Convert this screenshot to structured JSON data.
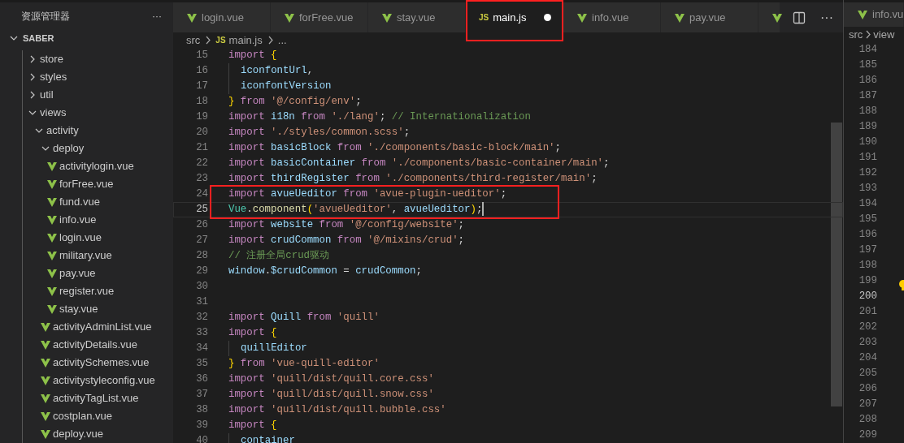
{
  "explorer": {
    "title": "资源管理器",
    "more": "···",
    "root": {
      "label": "SABER",
      "expanded": true
    },
    "items": [
      {
        "label": "store",
        "kind": "folder",
        "expanded": false
      },
      {
        "label": "styles",
        "kind": "folder",
        "expanded": false
      },
      {
        "label": "util",
        "kind": "folder",
        "expanded": false
      },
      {
        "label": "views",
        "kind": "folder",
        "expanded": true,
        "children": [
          {
            "label": "activity",
            "kind": "folder",
            "expanded": true,
            "children": [
              {
                "label": "deploy",
                "kind": "folder",
                "expanded": true,
                "children": [
                  {
                    "label": "activitylogin.vue",
                    "kind": "vue"
                  },
                  {
                    "label": "forFree.vue",
                    "kind": "vue"
                  },
                  {
                    "label": "fund.vue",
                    "kind": "vue"
                  },
                  {
                    "label": "info.vue",
                    "kind": "vue"
                  },
                  {
                    "label": "login.vue",
                    "kind": "vue"
                  },
                  {
                    "label": "military.vue",
                    "kind": "vue"
                  },
                  {
                    "label": "pay.vue",
                    "kind": "vue"
                  },
                  {
                    "label": "register.vue",
                    "kind": "vue"
                  },
                  {
                    "label": "stay.vue",
                    "kind": "vue"
                  }
                ]
              },
              {
                "label": "activityAdminList.vue",
                "kind": "vue"
              },
              {
                "label": "activityDetails.vue",
                "kind": "vue"
              },
              {
                "label": "activitySchemes.vue",
                "kind": "vue"
              },
              {
                "label": "activitystyleconfig.vue",
                "kind": "vue"
              },
              {
                "label": "activityTagList.vue",
                "kind": "vue"
              },
              {
                "label": "costplan.vue",
                "kind": "vue"
              },
              {
                "label": "deploy.vue",
                "kind": "vue"
              }
            ]
          }
        ]
      }
    ]
  },
  "tabs": [
    {
      "label": "login.vue",
      "kind": "vue",
      "selected": false
    },
    {
      "label": "forFree.vue",
      "kind": "vue",
      "selected": false
    },
    {
      "label": "stay.vue",
      "kind": "vue",
      "selected": false
    },
    {
      "label": "main.js",
      "kind": "js",
      "badge": "JS",
      "selected": true,
      "modified": true,
      "annotated": true
    },
    {
      "label": "info.vue",
      "kind": "vue",
      "selected": false
    },
    {
      "label": "pay.vue",
      "kind": "vue",
      "selected": false
    },
    {
      "kind": "vue",
      "selected": false
    }
  ],
  "tab_actions": {
    "more": "···"
  },
  "breadcrumb": [
    {
      "text": "src"
    },
    {
      "text": "main.js",
      "badge": "JS"
    },
    {
      "text": "..."
    }
  ],
  "code": [
    {
      "n": "15",
      "tokens": [
        {
          "kind": "kw",
          "text": "import"
        },
        {
          "kind": "brace",
          "text": " {"
        }
      ]
    },
    {
      "n": "16",
      "guide": true,
      "tokens": [
        {
          "kind": "var",
          "text": "iconfontUrl"
        },
        {
          "kind": "punc",
          "text": ","
        }
      ]
    },
    {
      "n": "17",
      "guide": true,
      "tokens": [
        {
          "kind": "var",
          "text": "iconfontVersion"
        }
      ]
    },
    {
      "n": "18",
      "tokens": [
        {
          "kind": "brace",
          "text": "}"
        },
        {
          "kind": "kw",
          "text": " from"
        },
        {
          "kind": "str",
          "text": " '@/config/env'"
        },
        {
          "kind": "punc",
          "text": ";"
        }
      ]
    },
    {
      "n": "19",
      "tokens": [
        {
          "kind": "kw",
          "text": "import"
        },
        {
          "kind": "var",
          "text": " i18n"
        },
        {
          "kind": "kw",
          "text": " from"
        },
        {
          "kind": "str",
          "text": " './lang'"
        },
        {
          "kind": "punc",
          "text": ";"
        },
        {
          "kind": "com",
          "text": " // Internationalization"
        }
      ]
    },
    {
      "n": "20",
      "tokens": [
        {
          "kind": "kw",
          "text": "import"
        },
        {
          "kind": "str",
          "text": " './styles/common.scss'"
        },
        {
          "kind": "punc",
          "text": ";"
        }
      ]
    },
    {
      "n": "21",
      "tokens": [
        {
          "kind": "kw",
          "text": "import"
        },
        {
          "kind": "var",
          "text": " basicBlock"
        },
        {
          "kind": "kw",
          "text": " from"
        },
        {
          "kind": "str",
          "text": " './components/basic-block/main'"
        },
        {
          "kind": "punc",
          "text": ";"
        }
      ]
    },
    {
      "n": "22",
      "tokens": [
        {
          "kind": "kw",
          "text": "import"
        },
        {
          "kind": "var",
          "text": " basicContainer"
        },
        {
          "kind": "kw",
          "text": " from"
        },
        {
          "kind": "str",
          "text": " './components/basic-container/main'"
        },
        {
          "kind": "punc",
          "text": ";"
        }
      ]
    },
    {
      "n": "23",
      "tokens": [
        {
          "kind": "kw",
          "text": "import"
        },
        {
          "kind": "var",
          "text": " thirdRegister"
        },
        {
          "kind": "kw",
          "text": " from"
        },
        {
          "kind": "str",
          "text": " './components/third-register/main'"
        },
        {
          "kind": "punc",
          "text": ";"
        }
      ]
    },
    {
      "n": "24",
      "annotated": true,
      "tokens": [
        {
          "kind": "kw",
          "text": "import"
        },
        {
          "kind": "var",
          "text": " avueUeditor"
        },
        {
          "kind": "kw",
          "text": " from"
        },
        {
          "kind": "str",
          "text": " 'avue-plugin-ueditor'"
        },
        {
          "kind": "punc",
          "text": ";"
        }
      ]
    },
    {
      "n": "25",
      "current": true,
      "annotated": true,
      "tokens": [
        {
          "kind": "cls",
          "text": "Vue"
        },
        {
          "kind": "punc",
          "text": "."
        },
        {
          "kind": "fn",
          "text": "component"
        },
        {
          "kind": "brace",
          "text": "("
        },
        {
          "kind": "str",
          "text": "'avueUeditor'"
        },
        {
          "kind": "punc",
          "text": ","
        },
        {
          "kind": "var",
          "text": " avueUeditor"
        },
        {
          "kind": "brace",
          "text": ")"
        },
        {
          "kind": "punc",
          "text": ";"
        }
      ]
    },
    {
      "n": "26",
      "tokens": [
        {
          "kind": "kw",
          "text": "import"
        },
        {
          "kind": "var",
          "text": " website"
        },
        {
          "kind": "kw",
          "text": " from"
        },
        {
          "kind": "str",
          "text": " '@/config/website'"
        },
        {
          "kind": "punc",
          "text": ";"
        }
      ]
    },
    {
      "n": "27",
      "tokens": [
        {
          "kind": "kw",
          "text": "import"
        },
        {
          "kind": "var",
          "text": " crudCommon"
        },
        {
          "kind": "kw",
          "text": " from"
        },
        {
          "kind": "str",
          "text": " '@/mixins/crud'"
        },
        {
          "kind": "punc",
          "text": ";"
        }
      ]
    },
    {
      "n": "28",
      "tokens": [
        {
          "kind": "com",
          "text": "// 注册全局crud驱动"
        }
      ]
    },
    {
      "n": "29",
      "tokens": [
        {
          "kind": "var",
          "text": "window"
        },
        {
          "kind": "punc",
          "text": "."
        },
        {
          "kind": "var",
          "text": "$crudCommon"
        },
        {
          "kind": "punc",
          "text": " ="
        },
        {
          "kind": "var",
          "text": " crudCommon"
        },
        {
          "kind": "punc",
          "text": ";"
        }
      ]
    },
    {
      "n": "30"
    },
    {
      "n": "31"
    },
    {
      "n": "32",
      "tokens": [
        {
          "kind": "kw",
          "text": "import"
        },
        {
          "kind": "var",
          "text": " Quill"
        },
        {
          "kind": "kw",
          "text": " from"
        },
        {
          "kind": "str",
          "text": " 'quill'"
        }
      ]
    },
    {
      "n": "33",
      "tokens": [
        {
          "kind": "kw",
          "text": "import"
        },
        {
          "kind": "brace",
          "text": " {"
        }
      ]
    },
    {
      "n": "34",
      "guide": true,
      "tokens": [
        {
          "kind": "var",
          "text": "quillEditor"
        }
      ]
    },
    {
      "n": "35",
      "tokens": [
        {
          "kind": "brace",
          "text": "}"
        },
        {
          "kind": "kw",
          "text": " from"
        },
        {
          "kind": "str",
          "text": " 'vue-quill-editor'"
        }
      ]
    },
    {
      "n": "36",
      "tokens": [
        {
          "kind": "kw",
          "text": "import"
        },
        {
          "kind": "str",
          "text": " 'quill/dist/quill.core.css'"
        }
      ]
    },
    {
      "n": "37",
      "tokens": [
        {
          "kind": "kw",
          "text": "import"
        },
        {
          "kind": "str",
          "text": " 'quill/dist/quill.snow.css'"
        }
      ]
    },
    {
      "n": "38",
      "tokens": [
        {
          "kind": "kw",
          "text": "import"
        },
        {
          "kind": "str",
          "text": " 'quill/dist/quill.bubble.css'"
        }
      ]
    },
    {
      "n": "39",
      "tokens": [
        {
          "kind": "kw",
          "text": "import"
        },
        {
          "kind": "brace",
          "text": " {"
        }
      ]
    },
    {
      "n": "40",
      "guide": true,
      "tokens": [
        {
          "kind": "var",
          "text": "container"
        }
      ]
    }
  ],
  "side_editor": {
    "tab": {
      "label": "info.vu",
      "kind": "vue"
    },
    "breadcrumb": [
      {
        "text": "src"
      },
      {
        "text": "view"
      }
    ],
    "line_numbers": [
      {
        "n": "184"
      },
      {
        "n": "185"
      },
      {
        "n": "186"
      },
      {
        "n": "187"
      },
      {
        "n": "188"
      },
      {
        "n": "189"
      },
      {
        "n": "190"
      },
      {
        "n": "191"
      },
      {
        "n": "192"
      },
      {
        "n": "193"
      },
      {
        "n": "194"
      },
      {
        "n": "195"
      },
      {
        "n": "196"
      },
      {
        "n": "197"
      },
      {
        "n": "198"
      },
      {
        "n": "199"
      },
      {
        "n": "200",
        "current": true
      },
      {
        "n": "201"
      },
      {
        "n": "202"
      },
      {
        "n": "203"
      },
      {
        "n": "204"
      },
      {
        "n": "205"
      },
      {
        "n": "206"
      },
      {
        "n": "207"
      },
      {
        "n": "208"
      },
      {
        "n": "209"
      }
    ]
  }
}
